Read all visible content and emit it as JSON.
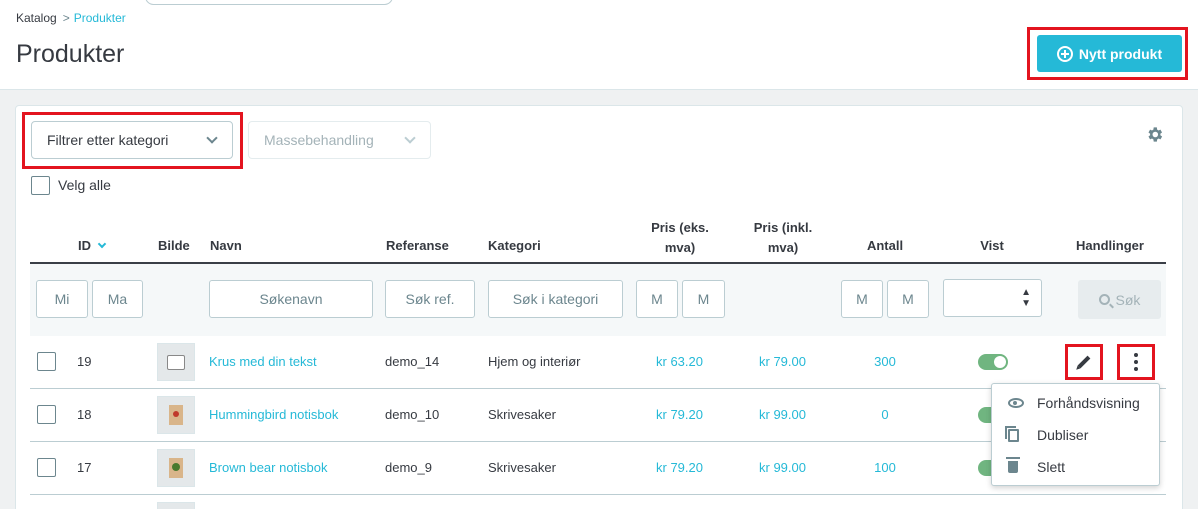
{
  "breadcrumb": {
    "parent": "Katalog",
    "separator": ">",
    "current": "Produkter"
  },
  "page": {
    "title": "Produkter"
  },
  "header": {
    "new_product_label": "Nytt produkt"
  },
  "toolbar": {
    "filter_category_label": "Filtrer etter kategori",
    "bulk_label": "Massebehandling",
    "select_all_label": "Velg alle",
    "settings_icon": "gear-icon"
  },
  "table": {
    "columns": {
      "id": "ID",
      "image": "Bilde",
      "name": "Navn",
      "reference": "Referanse",
      "category": "Kategori",
      "price_excl_1": "Pris (eks.",
      "price_excl_2": "mva)",
      "price_incl_1": "Pris (inkl.",
      "price_incl_2": "mva)",
      "quantity": "Antall",
      "shown": "Vist",
      "actions": "Handlinger"
    },
    "filters": {
      "id_min_placeholder": "Mi",
      "id_max_placeholder": "Ma",
      "name_placeholder": "Søkenavn",
      "reference_placeholder": "Søk ref.",
      "category_placeholder": "Søk i kategori",
      "price_excl_min_placeholder": "M",
      "price_excl_max_placeholder": "M",
      "quantity_min_placeholder": "M",
      "quantity_max_placeholder": "M",
      "shown_selected": "",
      "search_button": "Søk"
    },
    "rows": [
      {
        "id": "19",
        "name": "Krus med din tekst",
        "reference": "demo_14",
        "category": "Hjem og interiør",
        "price_excl": "kr 63.20",
        "price_incl": "kr 79.00",
        "quantity": "300",
        "shown": true
      },
      {
        "id": "18",
        "name": "Hummingbird notisbok",
        "reference": "demo_10",
        "category": "Skrivesaker",
        "price_excl": "kr 79.20",
        "price_incl": "kr 99.00",
        "quantity": "0",
        "shown": true
      },
      {
        "id": "17",
        "name": "Brown bear notisbok",
        "reference": "demo_9",
        "category": "Skrivesaker",
        "price_excl": "kr 79.20",
        "price_incl": "kr 99.00",
        "quantity": "100",
        "shown": true
      }
    ]
  },
  "row_menu": {
    "items": [
      {
        "label": "Forhåndsvisning",
        "icon": "eye-icon"
      },
      {
        "label": "Dubliser",
        "icon": "copy-icon"
      },
      {
        "label": "Slett",
        "icon": "trash-icon"
      }
    ]
  },
  "colors": {
    "accent": "#25b9d7",
    "highlight": "#e3141f",
    "toggle_on": "#70b580"
  }
}
